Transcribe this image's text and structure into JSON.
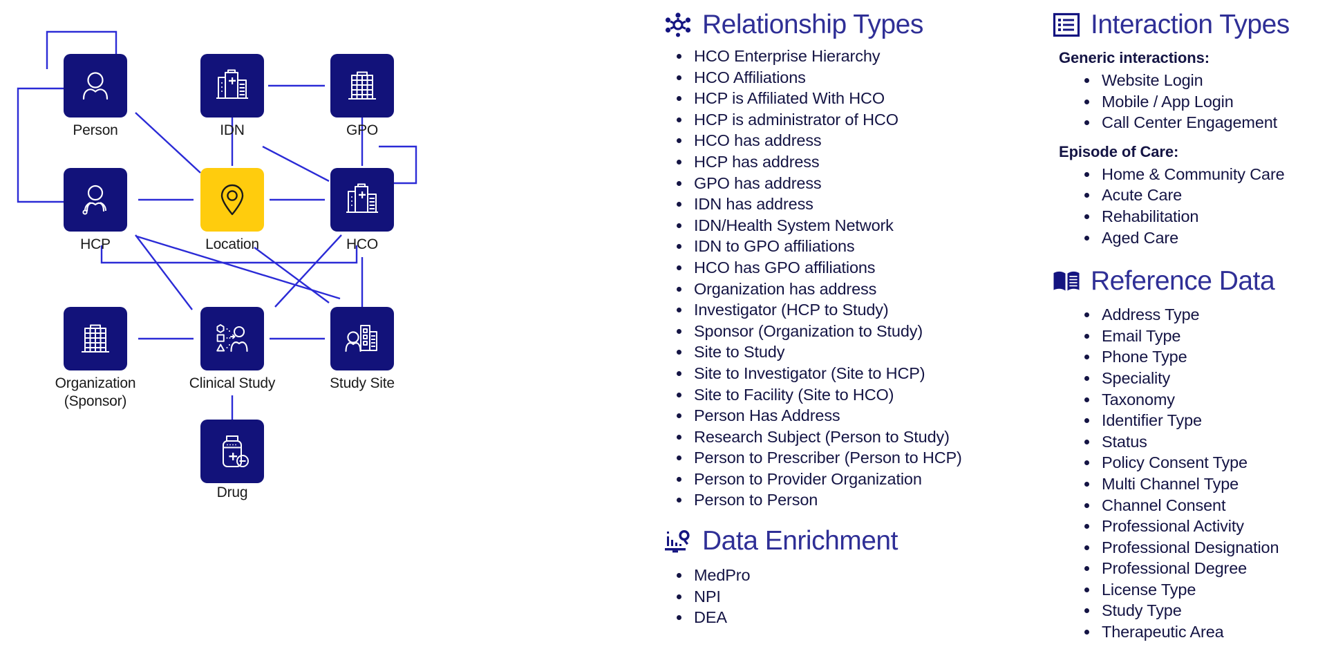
{
  "diagram": {
    "nodes": [
      {
        "id": "person",
        "label": "Person",
        "icon": "person-icon",
        "accent": false
      },
      {
        "id": "idn",
        "label": "IDN",
        "icon": "hospital-icon",
        "accent": false
      },
      {
        "id": "gpo",
        "label": "GPO",
        "icon": "office-building-icon",
        "accent": false
      },
      {
        "id": "hcp",
        "label": "HCP",
        "icon": "doctor-icon",
        "accent": false
      },
      {
        "id": "location",
        "label": "Location",
        "icon": "map-pin-icon",
        "accent": true
      },
      {
        "id": "hco",
        "label": "HCO",
        "icon": "hospital-icon",
        "accent": false
      },
      {
        "id": "organization",
        "label": "Organization\n(Sponsor)",
        "icon": "office-building-icon",
        "accent": false
      },
      {
        "id": "study",
        "label": "Clinical Study",
        "icon": "clinical-study-icon",
        "accent": false
      },
      {
        "id": "site",
        "label": "Study Site",
        "icon": "study-site-icon",
        "accent": false
      },
      {
        "id": "drug",
        "label": "Drug",
        "icon": "drug-bottle-icon",
        "accent": false
      }
    ],
    "colors": {
      "node": "#12127a",
      "accent": "#ffcc0d",
      "connector": "#2b2bd6",
      "label": "#1a1a1a"
    }
  },
  "relationship_types": {
    "title": "Relationship Types",
    "icon": "network-nodes-icon",
    "items": [
      "HCO Enterprise Hierarchy",
      "HCO Affiliations",
      "HCP is Affiliated With HCO",
      "HCP is administrator of HCO",
      "HCO has address",
      "HCP has address",
      "GPO has address",
      "IDN has address",
      "IDN/Health System Network",
      "IDN to GPO affiliations",
      "HCO has GPO affiliations",
      "Organization has address",
      "Investigator (HCP to Study)",
      "Sponsor (Organization  to Study)",
      "Site to Study",
      "Site to Investigator (Site to HCP)",
      "Site to Facility (Site to HCO)",
      "Person Has Address",
      "Research Subject (Person to Study)",
      "Person to Prescriber (Person to HCP)",
      "Person to Provider Organization",
      "Person to Person"
    ]
  },
  "data_enrichment": {
    "title": "Data Enrichment",
    "icon": "chart-search-icon",
    "items": [
      "MedPro",
      "NPI",
      "DEA"
    ]
  },
  "interaction_types": {
    "title": "Interaction Types",
    "icon": "list-box-icon",
    "groups": [
      {
        "heading": "Generic interactions:",
        "items": [
          "Website Login",
          "Mobile / App Login",
          "Call Center Engagement"
        ]
      },
      {
        "heading": "Episode of Care:",
        "items": [
          "Home & Community Care",
          "Acute Care",
          "Rehabilitation",
          "Aged Care"
        ]
      }
    ]
  },
  "reference_data": {
    "title": "Reference Data",
    "icon": "open-book-icon",
    "items": [
      "Address Type",
      "Email Type",
      "Phone Type",
      "Speciality",
      "Taxonomy",
      "Identifier Type",
      "Status",
      "Policy Consent Type",
      "Multi Channel Type",
      "Channel Consent",
      "Professional Activity",
      "Professional Designation",
      "Professional Degree",
      "License Type",
      "Study Type",
      "Therapeutic Area"
    ]
  }
}
